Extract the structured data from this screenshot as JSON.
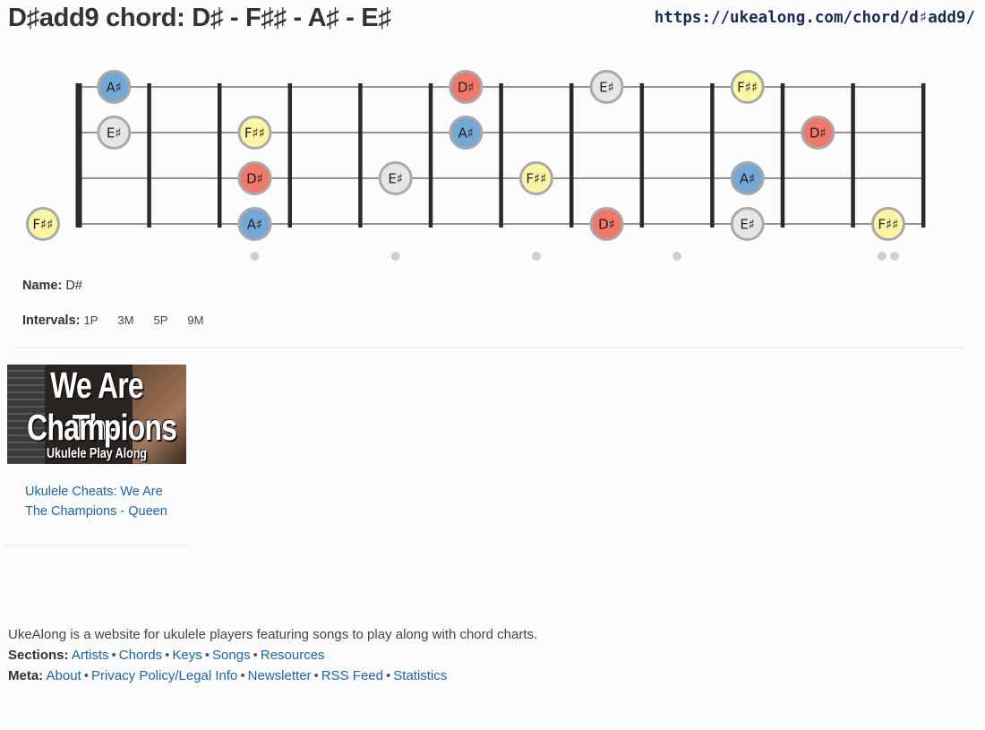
{
  "header": {
    "title": "D♯add9 chord: D♯ - F♯♯ - A♯ - E♯",
    "url": "https://ukealong.com/chord/d♯add9/"
  },
  "fretboard": {
    "strings": 4,
    "frets": 12,
    "colors": {
      "root": "#f0786a",
      "third": "#fbf6a4",
      "fifth": "#74a8d4",
      "ninth": "#e6e6e6"
    },
    "notes": [
      {
        "string": 1,
        "fret": 1,
        "label": "A♯",
        "role": "fifth"
      },
      {
        "string": 1,
        "fret": 6,
        "label": "D♯",
        "role": "root"
      },
      {
        "string": 1,
        "fret": 8,
        "label": "E♯",
        "role": "ninth"
      },
      {
        "string": 1,
        "fret": 10,
        "label": "F♯♯",
        "role": "third"
      },
      {
        "string": 2,
        "fret": 1,
        "label": "E♯",
        "role": "ninth"
      },
      {
        "string": 2,
        "fret": 3,
        "label": "F♯♯",
        "role": "third"
      },
      {
        "string": 2,
        "fret": 6,
        "label": "A♯",
        "role": "fifth"
      },
      {
        "string": 2,
        "fret": 11,
        "label": "D♯",
        "role": "root"
      },
      {
        "string": 3,
        "fret": 3,
        "label": "D♯",
        "role": "root"
      },
      {
        "string": 3,
        "fret": 5,
        "label": "E♯",
        "role": "ninth"
      },
      {
        "string": 3,
        "fret": 7,
        "label": "F♯♯",
        "role": "third"
      },
      {
        "string": 3,
        "fret": 10,
        "label": "A♯",
        "role": "fifth"
      },
      {
        "string": 4,
        "fret": 0,
        "label": "F♯♯",
        "role": "third"
      },
      {
        "string": 4,
        "fret": 3,
        "label": "A♯",
        "role": "fifth"
      },
      {
        "string": 4,
        "fret": 8,
        "label": "D♯",
        "role": "root"
      },
      {
        "string": 4,
        "fret": 10,
        "label": "E♯",
        "role": "ninth"
      },
      {
        "string": 4,
        "fret": 12,
        "label": "F♯♯",
        "role": "third"
      }
    ],
    "markers": [
      3,
      5,
      7,
      9
    ],
    "double_marker": 12
  },
  "info": {
    "name_label": "Name:",
    "name_value": "D#",
    "intervals_label": "Intervals:",
    "intervals": [
      "1P",
      "3M",
      "5P",
      "9M"
    ]
  },
  "video": {
    "thumb_line1": "We Are The",
    "thumb_line2": "Champions",
    "thumb_line3": "Ukulele Play Along",
    "link_text": "Ukulele Cheats: We Are The Champions - Queen"
  },
  "footer": {
    "description": "UkeAlong is a website for ukulele players featuring songs to play along with chord charts.",
    "sections_label": "Sections:",
    "sections": [
      "Artists",
      "Chords",
      "Keys",
      "Songs",
      "Resources"
    ],
    "meta_label": "Meta:",
    "meta": [
      "About",
      "Privacy Policy/Legal Info",
      "Newsletter",
      "RSS Feed",
      "Statistics"
    ]
  }
}
